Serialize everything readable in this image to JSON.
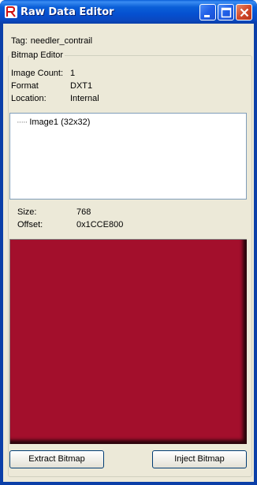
{
  "window": {
    "title": "Raw Data Editor",
    "icons": {
      "app": "app-icon",
      "minimize": "minimize-icon",
      "maximize": "maximize-icon",
      "close": "close-icon"
    }
  },
  "tag": {
    "label": "Tag:",
    "value": "needler_contrail"
  },
  "group": {
    "legend": "Bitmap Editor"
  },
  "info": {
    "image_count_label": "Image Count:",
    "image_count_value": "1",
    "format_label": "Format",
    "format_value": "DXT1",
    "location_label": "Location:",
    "location_value": "Internal"
  },
  "tree": {
    "items": [
      {
        "label": "Image1 (32x32)"
      }
    ]
  },
  "stats": {
    "size_label": "Size:",
    "size_value": "768",
    "offset_label": "Offset:",
    "offset_value": "0x1CCE800"
  },
  "preview": {
    "color": "#a30f2c"
  },
  "buttons": {
    "extract": "Extract Bitmap",
    "inject": "Inject Bitmap"
  }
}
